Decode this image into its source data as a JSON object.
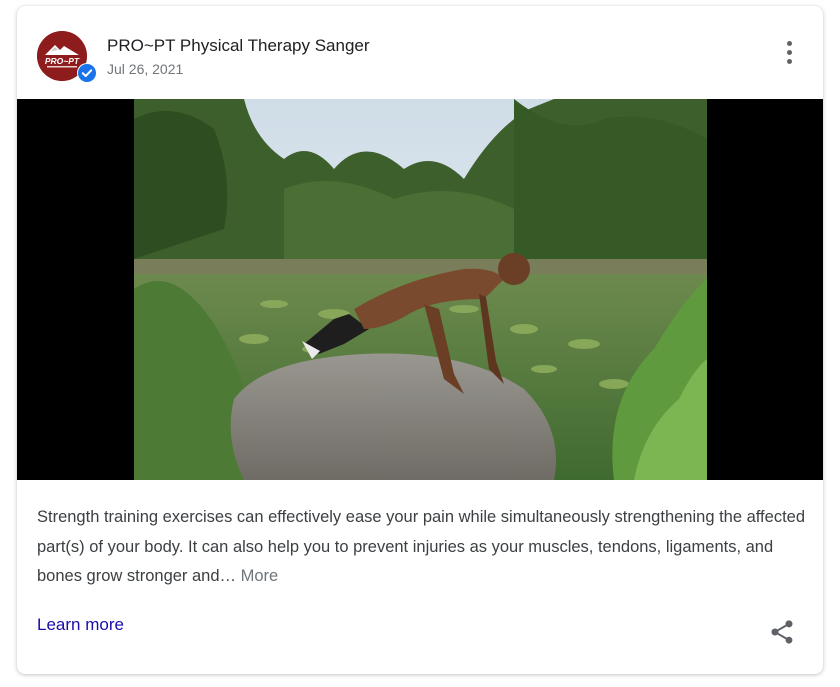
{
  "post": {
    "business_name": "PRO~PT Physical Therapy Sanger",
    "date": "Jul 26, 2021",
    "avatar_logo_text": "PRO~PT",
    "avatar_icon": "pro-pt-logo",
    "verified_icon": "verified-check-icon",
    "menu_icon": "more-vert-icon",
    "image_alt": "Man doing push-up on a rock beside a pond with lily pads and trees",
    "description": "Strength training exercises can effectively ease your pain while simultaneously strengthening the affected part(s) of your body. It can also help you to prevent injuries as your muscles, tendons, ligaments, and bones grow stronger and…",
    "more_label": "More",
    "learn_more_label": "Learn more",
    "share_icon": "share-icon"
  },
  "colors": {
    "brand": "#8f1c1c",
    "verified": "#1a73e8",
    "link": "#1a0dab",
    "text": "#3c4043",
    "muted": "#70757a"
  }
}
